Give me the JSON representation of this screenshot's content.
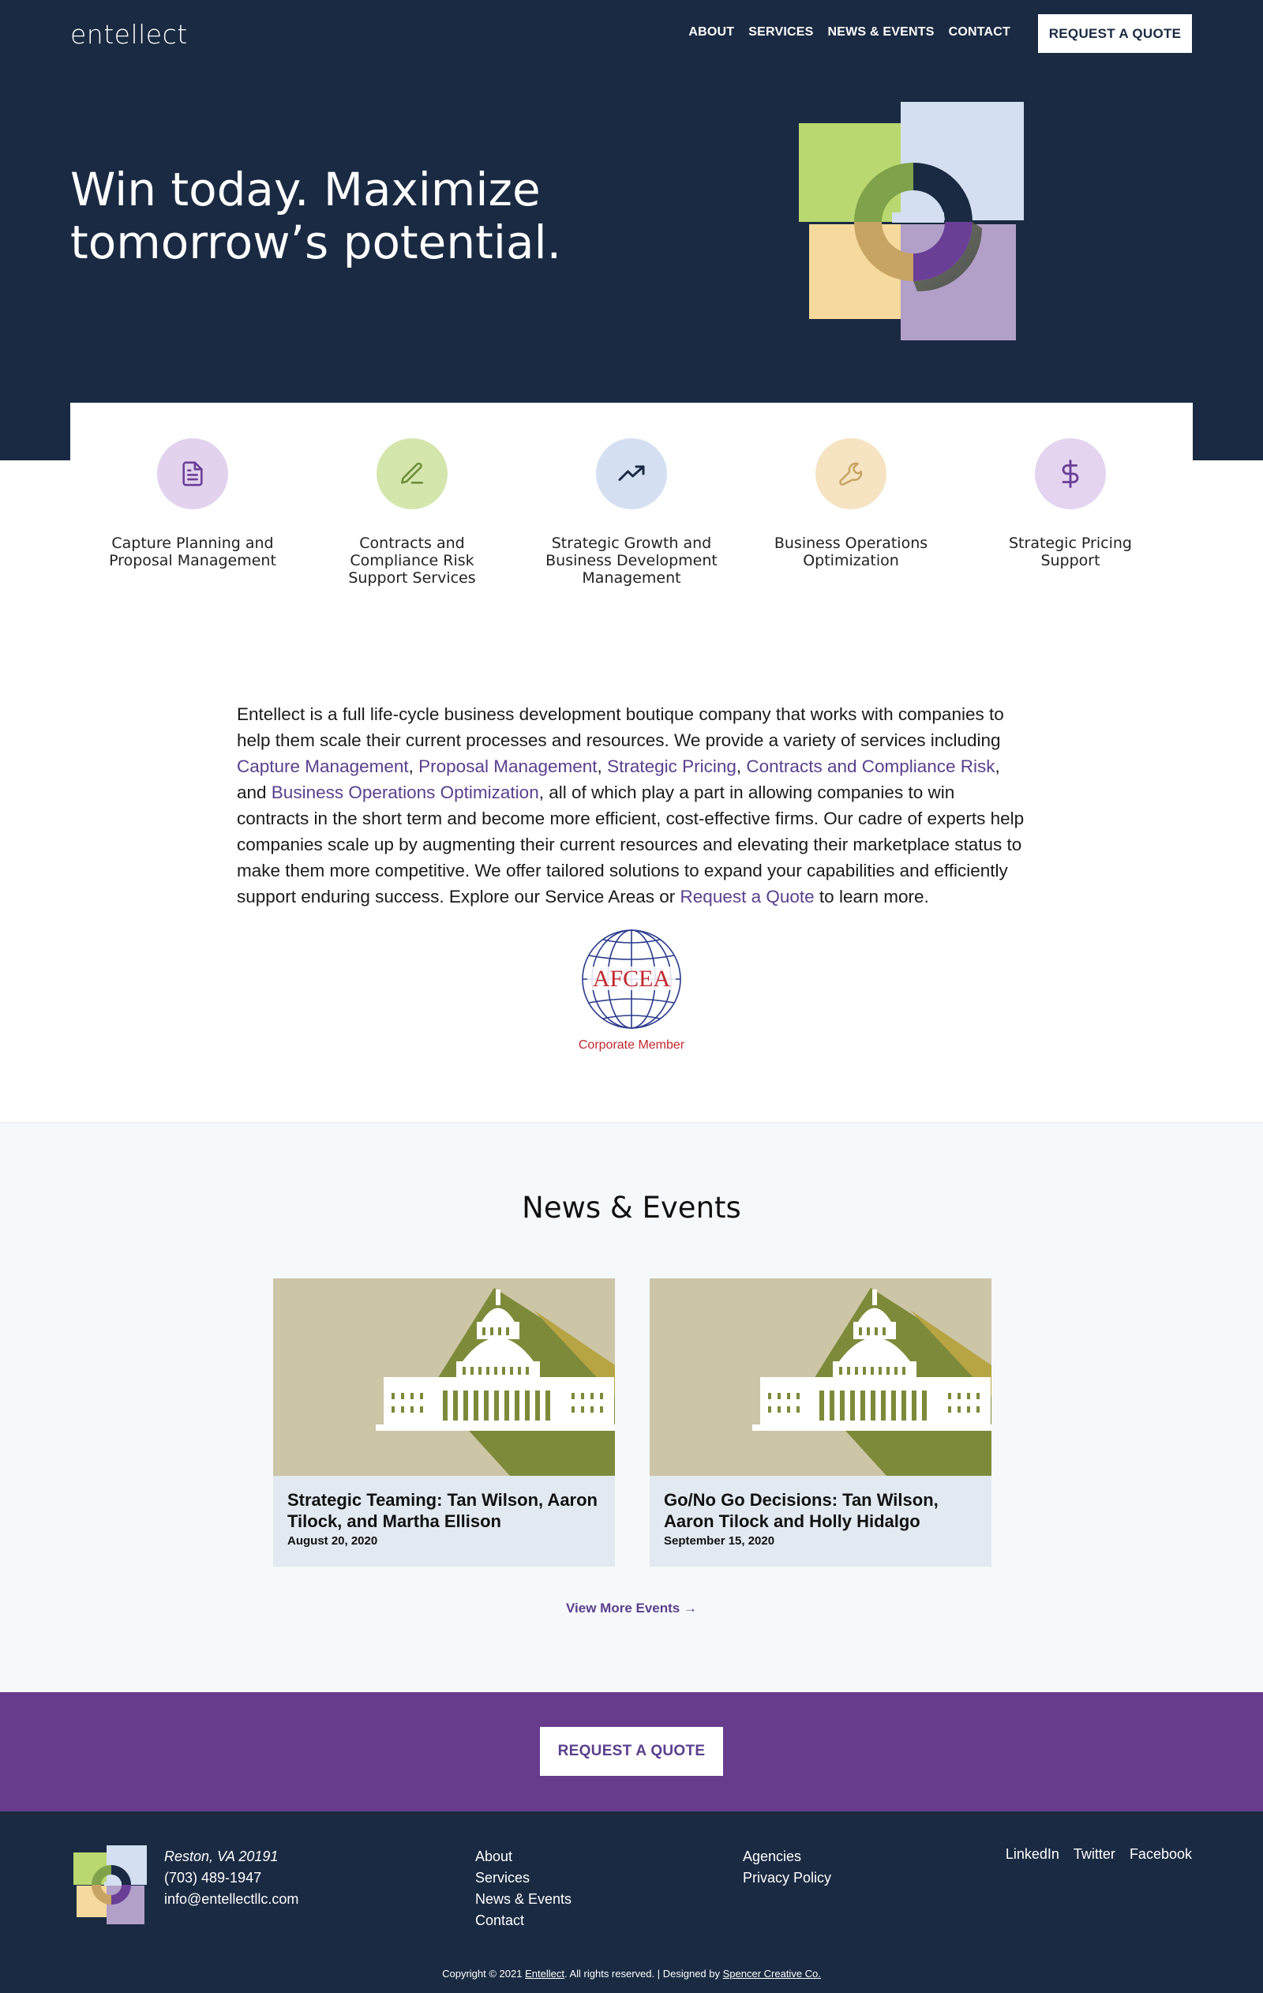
{
  "header": {
    "logo": "entellect",
    "nav": [
      "ABOUT",
      "SERVICES",
      "NEWS & EVENTS",
      "CONTACT"
    ],
    "quote_button": "REQUEST A QUOTE"
  },
  "hero": {
    "title": "Win today. Maximize tomorrow’s potential."
  },
  "services": [
    {
      "label": "Capture Planning and Proposal Management",
      "icon": "document-icon",
      "color": "#e2d2ee"
    },
    {
      "label": "Contracts and Compliance Risk Support Services",
      "icon": "pencil-icon",
      "color": "#d4e6ac"
    },
    {
      "label": "Strategic Growth and Business Development Management",
      "icon": "trending-up-icon",
      "color": "#d4e0f2"
    },
    {
      "label": "Business Operations Optimization",
      "icon": "wrench-icon",
      "color": "#f6e3c2"
    },
    {
      "label": "Strategic Pricing Support",
      "icon": "dollar-icon",
      "color": "#e4d4f0"
    }
  ],
  "about": {
    "p1": "Entellect is a full life-cycle business development boutique company that works with companies to help them scale their current processes and resources. We provide a variety of services including ",
    "link1": "Capture Management",
    "sep1": ", ",
    "link2": "Proposal Management",
    "sep2": ", ",
    "link3": "Strategic Pricing",
    "sep3": ", ",
    "link4": "Contracts and Compliance Risk",
    "sep4": ", and ",
    "link5": "Business Operations Optimization",
    "p2": ", all of which play a part in allowing companies to win contracts in the short term and become more efficient, cost-effective firms. Our cadre of experts help companies scale up by augmenting their current resources and elevating their marketplace status to make them more competitive. We offer tailored solutions to expand your capabilities and efficiently support enduring success. Explore our Service Areas or ",
    "link6": "Request a Quote",
    "p3": " to learn more."
  },
  "badge": {
    "name": "AFCEA",
    "caption": "Corporate Member"
  },
  "news": {
    "title": "News & Events",
    "cards": [
      {
        "title": "Strategic Teaming: Tan Wilson, Aaron Tilock, and Martha Ellison",
        "date": "August 20, 2020"
      },
      {
        "title": "Go/No Go Decisions: Tan Wilson, Aaron Tilock and Holly Hidalgo",
        "date": "September 15, 2020"
      }
    ],
    "more": "View More Events →"
  },
  "cta": {
    "button": "REQUEST A QUOTE"
  },
  "footer": {
    "city": "Reston, VA 20191",
    "phone": "(703) 489-1947",
    "email": "info@entellectllc.com",
    "col1": [
      "About",
      "Services",
      "News & Events",
      "Contact"
    ],
    "col2": [
      "Agencies",
      "Privacy Policy"
    ],
    "social": [
      "LinkedIn",
      "Twitter",
      "Facebook"
    ],
    "copy_pre": "Copyright © 2021 ",
    "copy_brand": "Entellect",
    "copy_mid": ". All rights reserved. | Designed by ",
    "copy_designer": "Spencer Creative Co."
  },
  "colors": {
    "navy": "#1a2a42",
    "purple": "#683c8c",
    "link": "#5a3f8c",
    "news_bg": "#f6f9fc"
  }
}
